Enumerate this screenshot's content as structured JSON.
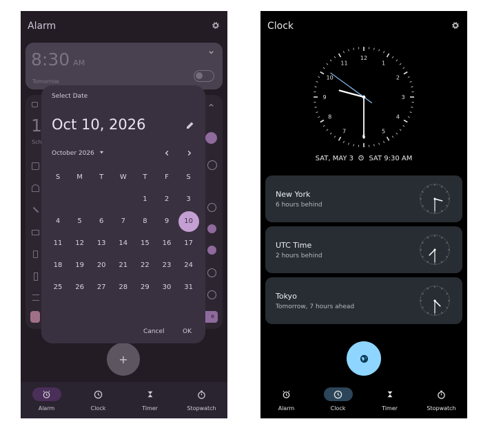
{
  "alarm_screen": {
    "title": "Alarm",
    "alarm_time": "8:30",
    "alarm_ampm": "AM",
    "alarm_day": "Tomorrow",
    "partial_big_digit": "1",
    "partial_sch": "Sch",
    "partial_e": "e",
    "date_picker": {
      "header": "Select Date",
      "selected_date": "Oct 10, 2026",
      "month_label": "October 2026",
      "weekdays": [
        "S",
        "M",
        "T",
        "W",
        "T",
        "F",
        "S"
      ],
      "days": [
        [
          "",
          "",
          "",
          "",
          "1",
          "2",
          "3"
        ],
        [
          "4",
          "5",
          "6",
          "7",
          "8",
          "9",
          "10"
        ],
        [
          "11",
          "12",
          "13",
          "14",
          "15",
          "16",
          "17"
        ],
        [
          "18",
          "19",
          "20",
          "21",
          "22",
          "23",
          "24"
        ],
        [
          "25",
          "26",
          "27",
          "28",
          "29",
          "30",
          "31"
        ]
      ],
      "selected_day": "10",
      "cancel_label": "Cancel",
      "ok_label": "OK"
    },
    "fab_label": "+"
  },
  "clock_screen": {
    "title": "Clock",
    "main_clock": {
      "hour": 9,
      "minute": 30,
      "second": 51
    },
    "date_line": "SAT, MAY 3",
    "next_alarm": "SAT 9:30 AM",
    "clock_numbers": [
      "12",
      "1",
      "2",
      "3",
      "4",
      "5",
      "6",
      "7",
      "8",
      "9",
      "10",
      "11"
    ],
    "cities": [
      {
        "name": "New York",
        "diff": "6 hours behind",
        "hour": 3,
        "minute": 30
      },
      {
        "name": "UTC Time",
        "diff": "2 hours behind",
        "hour": 7,
        "minute": 30
      },
      {
        "name": "Tokyo",
        "diff": "Tomorrow, 7 hours ahead",
        "hour": 4,
        "minute": 30
      }
    ]
  },
  "nav": {
    "items": [
      "Alarm",
      "Clock",
      "Timer",
      "Stopwatch"
    ]
  },
  "colors": {
    "alarm_bg": "#231c25",
    "dialog_bg": "#3a3140",
    "accent_purple": "#c49fd3",
    "clock_card_bg": "#282d33",
    "fab_blue": "#8ed6ff"
  }
}
